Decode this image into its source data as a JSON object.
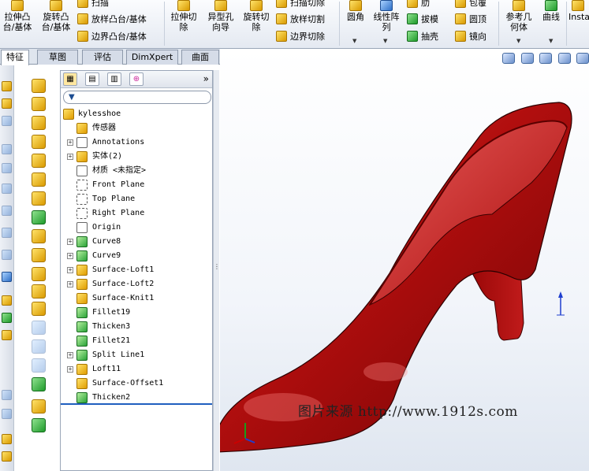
{
  "ribbon": {
    "extrude_boss": "拉伸凸\n台/基体",
    "revolve_boss": "旋转凸\n台/基体",
    "sweep": "扫描",
    "loft_boss": "放样凸台/基体",
    "boundary_boss": "边界凸台/基体",
    "extrude_cut": "拉伸切\n除",
    "hole_wizard": "异型孔\n向导",
    "revolve_cut": "旋转切\n除",
    "sweep_cut": "扫描切除",
    "loft_cut": "放样切割",
    "boundary_cut": "边界切除",
    "fillet": "圆角",
    "linear_pattern": "线性阵\n列",
    "rib": "肋",
    "draft": "拔模",
    "shell": "抽壳",
    "wrap": "包覆",
    "dome": "圆顶",
    "mirror": "镜向",
    "reference_geometry": "参考几\n何体",
    "curves": "曲线",
    "instant3d": "Insta"
  },
  "tabs": [
    {
      "label": "特征",
      "active": true
    },
    {
      "label": "草图",
      "active": false
    },
    {
      "label": "评估",
      "active": false
    },
    {
      "label": "DimXpert",
      "active": false
    },
    {
      "label": "曲面",
      "active": false
    }
  ],
  "feature_manager": {
    "collapse_glyph": "»",
    "filter_icon": "filter-icon",
    "tree": [
      {
        "label": "kylesshoe",
        "icon": "part-icon",
        "expand": false
      },
      {
        "label": "传感器",
        "icon": "sensor-icon",
        "expand": false
      },
      {
        "label": "Annotations",
        "icon": "annotations-icon",
        "expand": true
      },
      {
        "label": "实体(2)",
        "icon": "solid-bodies-icon",
        "expand": true
      },
      {
        "label": "材质 <未指定>",
        "icon": "material-icon",
        "expand": false
      },
      {
        "label": "Front Plane",
        "icon": "plane-icon",
        "expand": false
      },
      {
        "label": "Top Plane",
        "icon": "plane-icon",
        "expand": false
      },
      {
        "label": "Right Plane",
        "icon": "plane-icon",
        "expand": false
      },
      {
        "label": "Origin",
        "icon": "origin-icon",
        "expand": false
      },
      {
        "label": "Curve8",
        "icon": "curve-icon",
        "expand": true
      },
      {
        "label": "Curve9",
        "icon": "curve-icon",
        "expand": true
      },
      {
        "label": "Surface-Loft1",
        "icon": "surface-loft-icon",
        "expand": true
      },
      {
        "label": "Surface-Loft2",
        "icon": "surface-loft-icon",
        "expand": true
      },
      {
        "label": "Surface-Knit1",
        "icon": "surface-knit-icon",
        "expand": false
      },
      {
        "label": "Fillet19",
        "icon": "fillet-icon",
        "expand": false
      },
      {
        "label": "Thicken3",
        "icon": "thicken-icon",
        "expand": false
      },
      {
        "label": "Fillet21",
        "icon": "fillet-icon",
        "expand": false
      },
      {
        "label": "Split Line1",
        "icon": "split-line-icon",
        "expand": true
      },
      {
        "label": "Loft11",
        "icon": "loft-icon",
        "expand": true
      },
      {
        "label": "Surface-Offset1",
        "icon": "surface-offset-icon",
        "expand": false
      },
      {
        "label": "Thicken2",
        "icon": "thicken-icon",
        "expand": false
      }
    ]
  },
  "viewport": {
    "watermark": "图片来源 http://www.1912s.com",
    "model_color": "#b30d0d",
    "triad_x_color": "#cc0000",
    "triad_y_color": "#1a9c1a",
    "triad_z_color": "#1f3fcf"
  }
}
